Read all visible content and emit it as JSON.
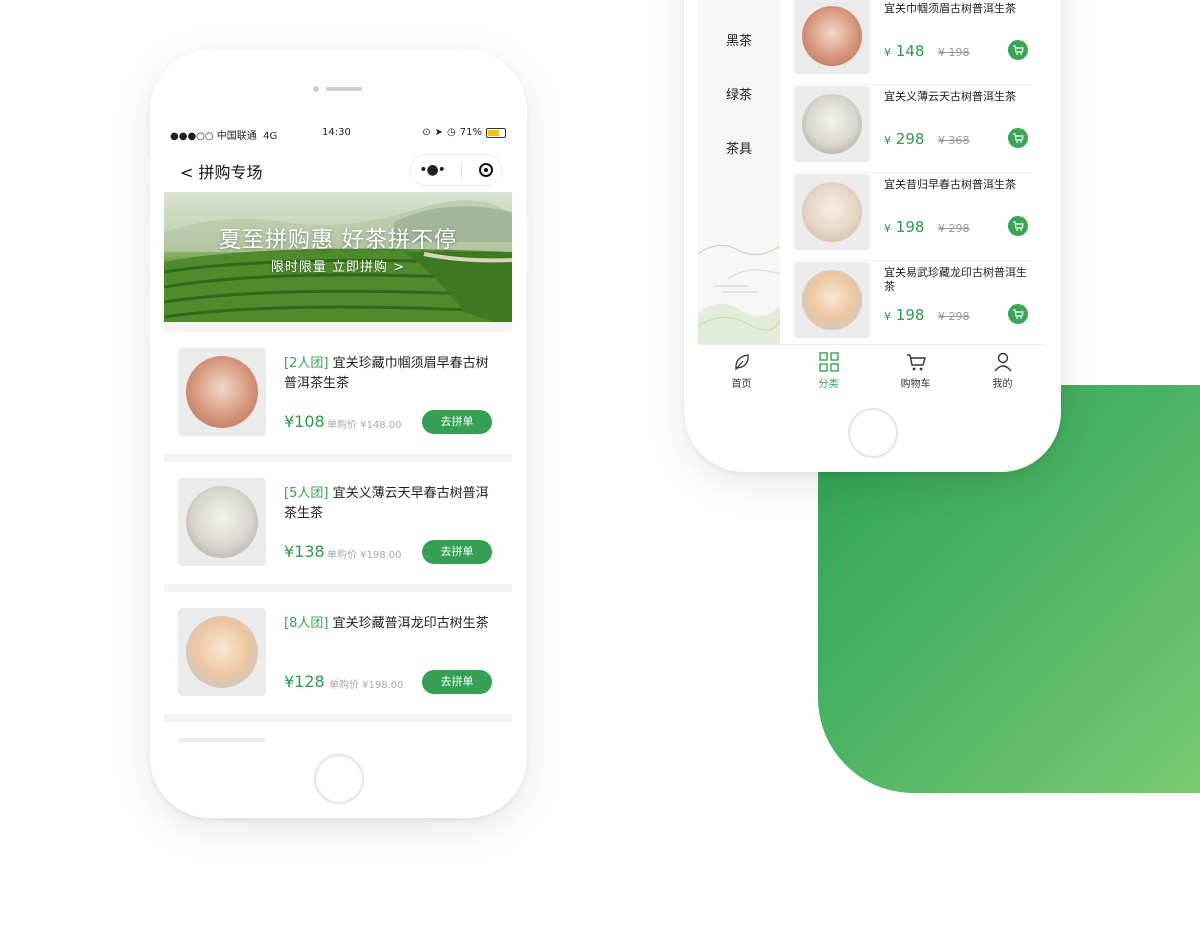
{
  "colors": {
    "accent": "#35a055",
    "background_block": "#4bb364",
    "banner_green": "#3f7a23"
  },
  "left_phone": {
    "status_bar": {
      "carrier": "●●●○○ 中国联通",
      "network": "4G",
      "time": "14:30",
      "battery": "71%"
    },
    "nav": {
      "back_icon": "chevron-left-icon",
      "title": "< 拼购专场",
      "more_icon": "more-dots-icon",
      "close_icon": "target-icon"
    },
    "banner": {
      "headline": "夏至拼购惠 好茶拼不停",
      "subline": "限时限量 立即拼购 >"
    },
    "products": [
      {
        "tag": "[2人团]",
        "name": "宜关珍藏巾帼须眉早春古树普洱茶生茶",
        "price": "¥108",
        "orig_price": "单购价 ¥148.00",
        "button": "去拼单"
      },
      {
        "tag": "[5人团]",
        "name": "宜关义薄云天早春古树普洱茶生茶",
        "price": "¥138",
        "orig_price": "单购价 ¥198.00",
        "button": "去拼单"
      },
      {
        "tag": "[8人团]",
        "name": "宜关珍藏普洱龙印古树生茶",
        "price": "¥128",
        "orig_price": "单购价 ¥198.00",
        "button": "去拼单"
      }
    ]
  },
  "right_phone": {
    "categories": [
      "黑茶",
      "绿茶",
      "茶具"
    ],
    "products": [
      {
        "name": "宜关巾帼须眉古树普洱生茶",
        "yen": "¥",
        "price": "148",
        "orig_price": "¥ 198"
      },
      {
        "name": "宜关义薄云天古树普洱生茶",
        "yen": "¥",
        "price": "298",
        "orig_price": "¥ 368"
      },
      {
        "name": "宜关昔归早春古树普洱生茶",
        "yen": "¥",
        "price": "198",
        "orig_price": "¥ 298"
      },
      {
        "name": "宜关易武珍藏龙印古树普洱生茶",
        "yen": "¥",
        "price": "198",
        "orig_price": "¥ 298"
      }
    ],
    "tabbar": [
      {
        "label": "首页",
        "icon": "leaf-icon",
        "active": false
      },
      {
        "label": "分类",
        "icon": "grid-icon",
        "active": true
      },
      {
        "label": "购物车",
        "icon": "cart-icon",
        "active": false
      },
      {
        "label": "我的",
        "icon": "user-icon",
        "active": false
      }
    ]
  }
}
